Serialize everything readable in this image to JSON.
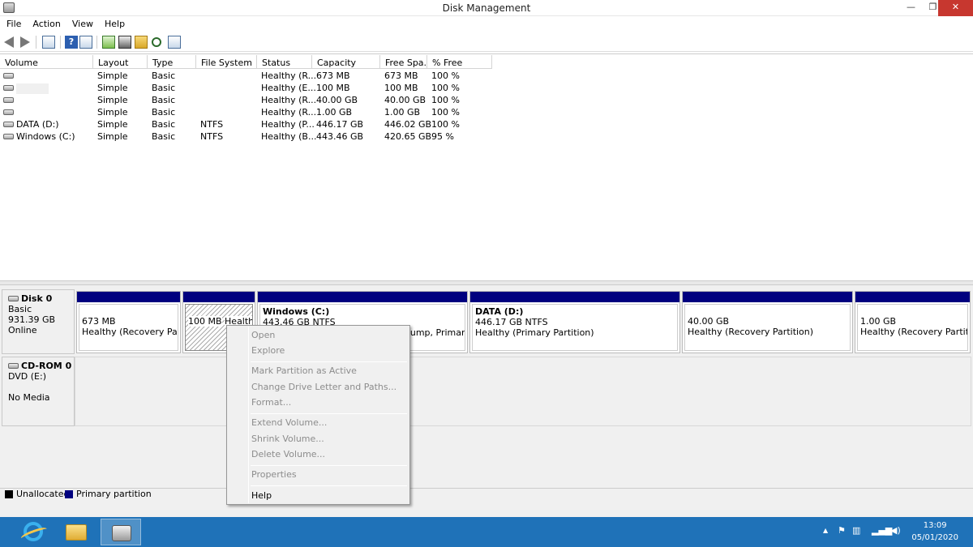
{
  "window": {
    "title": "Disk Management",
    "min_glyph": "—",
    "max_glyph": "❐",
    "close_glyph": "✕"
  },
  "menu": [
    "File",
    "Action",
    "View",
    "Help"
  ],
  "toolbar_icons": [
    "back-icon",
    "forward-icon",
    "console-tree-icon",
    "list-view-icon",
    "help-icon",
    "refresh-icon",
    "properties-icon",
    "open-icon",
    "search-icon",
    "settings-icon"
  ],
  "table": {
    "headers": [
      "Volume",
      "Layout",
      "Type",
      "File System",
      "Status",
      "Capacity",
      "Free Spa...",
      "% Free"
    ],
    "rows": [
      {
        "volume": "",
        "layout": "Simple",
        "type": "Basic",
        "fs": "",
        "status": "Healthy (R...",
        "capacity": "673 MB",
        "free": "673 MB",
        "pct": "100 %"
      },
      {
        "volume": "",
        "layout": "Simple",
        "type": "Basic",
        "fs": "",
        "status": "Healthy (E...",
        "capacity": "100 MB",
        "free": "100 MB",
        "pct": "100 %"
      },
      {
        "volume": "",
        "layout": "Simple",
        "type": "Basic",
        "fs": "",
        "status": "Healthy (R...",
        "capacity": "40.00 GB",
        "free": "40.00 GB",
        "pct": "100 %"
      },
      {
        "volume": "",
        "layout": "Simple",
        "type": "Basic",
        "fs": "",
        "status": "Healthy (R...",
        "capacity": "1.00 GB",
        "free": "1.00 GB",
        "pct": "100 %"
      },
      {
        "volume": "DATA (D:)",
        "layout": "Simple",
        "type": "Basic",
        "fs": "NTFS",
        "status": "Healthy (P...",
        "capacity": "446.17 GB",
        "free": "446.02 GB",
        "pct": "100 %"
      },
      {
        "volume": "Windows (C:)",
        "layout": "Simple",
        "type": "Basic",
        "fs": "NTFS",
        "status": "Healthy (B...",
        "capacity": "443.46 GB",
        "free": "420.65 GB",
        "pct": "95 %"
      }
    ]
  },
  "disk0": {
    "name": "Disk 0",
    "type": "Basic",
    "size": "931.39 GB",
    "state": "Online",
    "partitions": [
      {
        "title": "",
        "size": "673 MB",
        "status": "Healthy (Recovery Partition)"
      },
      {
        "title": "",
        "size": "100 MB",
        "status": "Healthy (EFI System Partition)"
      },
      {
        "title": "Windows  (C:)",
        "size": "443.46 GB NTFS",
        "status": "Healthy (Boot, Page File, Crash Dump, Primary Partition)"
      },
      {
        "title": "DATA  (D:)",
        "size": "446.17 GB NTFS",
        "status": "Healthy (Primary Partition)"
      },
      {
        "title": "",
        "size": "40.00 GB",
        "status": "Healthy (Recovery Partition)"
      },
      {
        "title": "",
        "size": "1.00 GB",
        "status": "Healthy (Recovery Partition)"
      }
    ]
  },
  "cdrom": {
    "name": "CD-ROM 0",
    "drive": "DVD (E:)",
    "media": "No Media"
  },
  "legend": [
    {
      "label": "Unallocated",
      "color": "#000000"
    },
    {
      "label": "Primary partition",
      "color": "#00007f"
    }
  ],
  "context_menu": {
    "items": [
      {
        "label": "Open",
        "enabled": false
      },
      {
        "label": "Explore",
        "enabled": false
      },
      {
        "label": "Mark Partition as Active",
        "enabled": false
      },
      {
        "label": "Change Drive Letter and Paths...",
        "enabled": false
      },
      {
        "label": "Format...",
        "enabled": false
      },
      {
        "label": "Extend Volume...",
        "enabled": false
      },
      {
        "label": "Shrink Volume...",
        "enabled": false
      },
      {
        "label": "Delete Volume...",
        "enabled": false
      },
      {
        "label": "Properties",
        "enabled": false
      },
      {
        "label": "Help",
        "enabled": true
      }
    ]
  },
  "taskbar": {
    "apps": [
      "internet-explorer-icon",
      "file-explorer-icon",
      "disk-management-icon"
    ],
    "time": "13:09",
    "date": "05/01/2020",
    "tray_up": "▲"
  }
}
